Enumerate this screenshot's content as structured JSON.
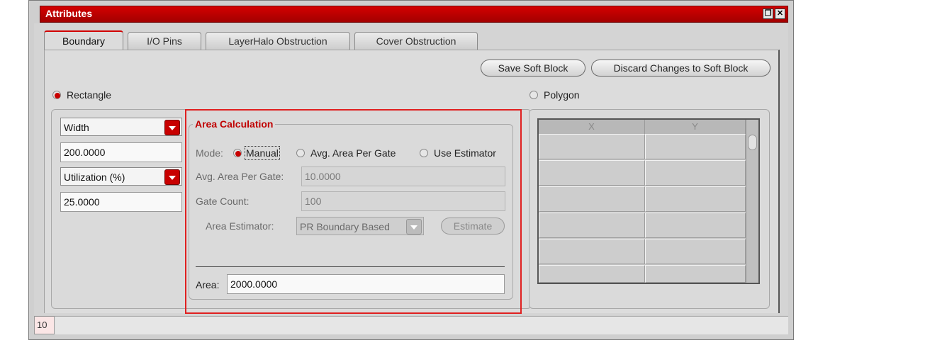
{
  "window": {
    "title": "Attributes",
    "controls": [
      "restore-icon",
      "close-icon"
    ],
    "accent": "#c80000"
  },
  "tabs": [
    {
      "label": "Boundary",
      "active": true
    },
    {
      "label": "I/O Pins",
      "active": false
    },
    {
      "label": "LayerHalo Obstruction",
      "active": false
    },
    {
      "label": "Cover Obstruction",
      "active": false
    }
  ],
  "actions": {
    "save": "Save Soft Block",
    "discard": "Discard Changes to Soft Block"
  },
  "shape": {
    "rectangle": "Rectangle",
    "polygon": "Polygon",
    "selected": "Rectangle"
  },
  "rectangle": {
    "dim_select": "Width",
    "dim_value": "200.0000",
    "util_select": "Utilization (%)",
    "util_value": "25.0000"
  },
  "area_calc": {
    "title": "Area Calculation",
    "mode_label": "Mode:",
    "modes": [
      "Manual",
      "Avg. Area Per Gate",
      "Use Estimator"
    ],
    "selected_mode": "Manual",
    "avg_label": "Avg. Area Per Gate:",
    "avg_value": "10.0000",
    "gate_label": "Gate Count:",
    "gate_value": "100",
    "estimator_label": "Area Estimator:",
    "estimator_value": "PR Boundary Based",
    "estimate_button": "Estimate",
    "area_label": "Area:",
    "area_value": "2000.0000"
  },
  "polygon_table": {
    "columns": [
      "X",
      "Y"
    ],
    "rows": [
      [
        "",
        ""
      ],
      [
        "",
        ""
      ],
      [
        "",
        ""
      ],
      [
        "",
        ""
      ],
      [
        "",
        ""
      ],
      [
        "",
        ""
      ]
    ]
  },
  "status": {
    "field": "10"
  }
}
